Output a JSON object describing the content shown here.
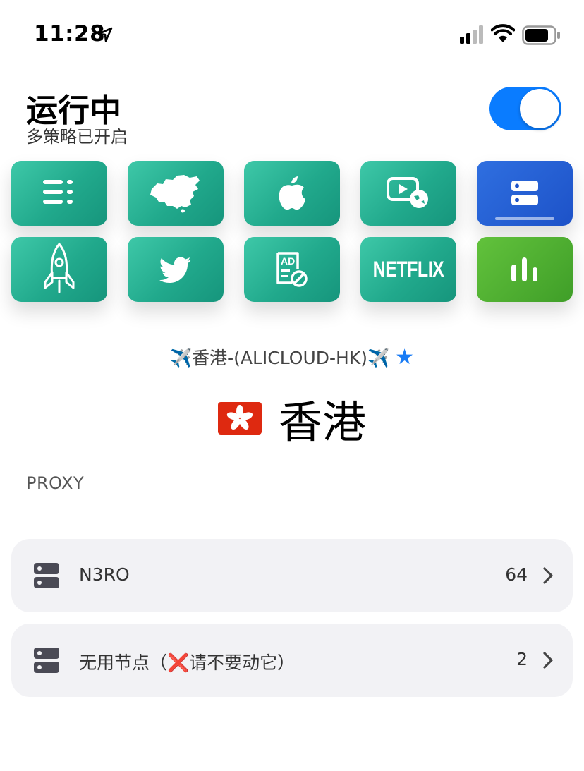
{
  "status_bar": {
    "time": "11:28"
  },
  "header": {
    "title": "运行中",
    "subtitle": "多策略已开启",
    "toggle_on": true,
    "toggle_color": "#0a7cff"
  },
  "tiles": [
    {
      "icon": "list-icon"
    },
    {
      "icon": "china-map-icon"
    },
    {
      "icon": "apple-icon"
    },
    {
      "icon": "video-globe-icon"
    },
    {
      "icon": "server-icon",
      "selected": true
    },
    {
      "icon": "rocket-icon"
    },
    {
      "icon": "twitter-icon"
    },
    {
      "icon": "ad-block-icon"
    },
    {
      "icon": "netflix-logo",
      "text": "NETFLIX"
    },
    {
      "icon": "bar-chart-icon"
    }
  ],
  "current": {
    "node_prefix": "✈️",
    "node_name": "香港-(ALICLOUD-HK)",
    "node_suffix": "✈️",
    "star": "★",
    "flag": "🇭🇰",
    "region": "香港"
  },
  "section_label": "PROXY",
  "groups": [
    {
      "name": "N3RO",
      "count": "64"
    },
    {
      "name_pre": "无用节点（",
      "mark": "❌",
      "name_post": "请不要动它）",
      "count": "2"
    }
  ],
  "colors": {
    "tile_teal": "#21a98c",
    "tile_blue": "#1d52c8",
    "tile_green": "#4fae30",
    "star": "#1a7cf5"
  }
}
